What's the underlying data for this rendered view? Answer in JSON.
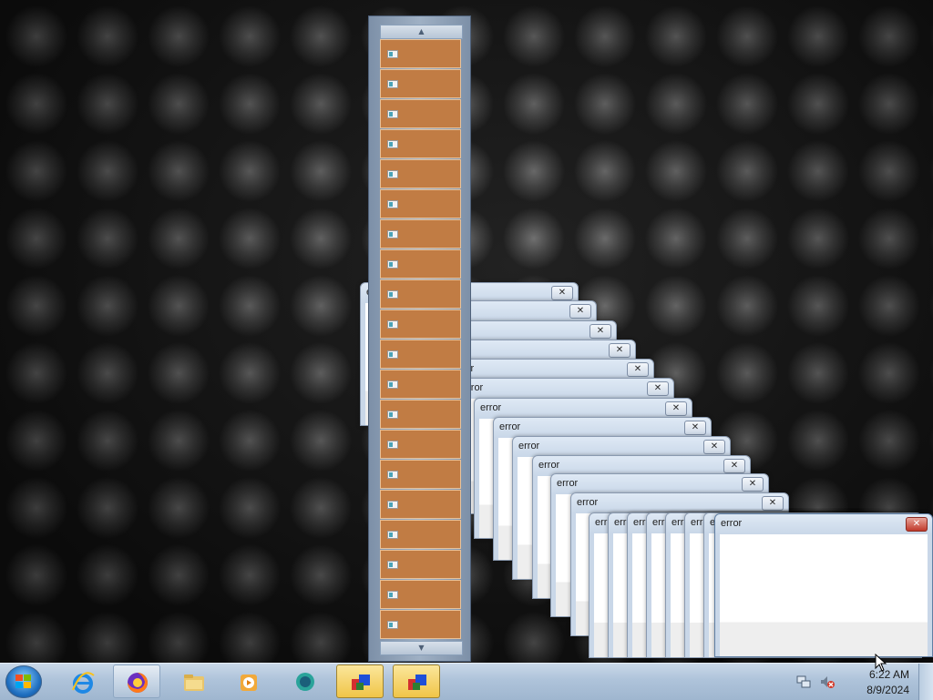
{
  "desktop": {
    "wallpaper": "dark-abstract-wallpaper"
  },
  "error_windows": {
    "title": "error",
    "close_glyph": "✕",
    "count": 23
  },
  "list_popup": {
    "scroll_up_glyph": "▲",
    "scroll_down_glyph": "▼",
    "item_count": 20,
    "item_icon": "app-window-icon"
  },
  "taskbar": {
    "start_icon": "windows-start-orb",
    "buttons": [
      {
        "name": "internet-explorer",
        "icon": "internet-explorer-icon",
        "state": "pinned"
      },
      {
        "name": "firefox",
        "icon": "firefox-icon",
        "state": "running"
      },
      {
        "name": "file-explorer",
        "icon": "folder-icon",
        "state": "pinned"
      },
      {
        "name": "media-player",
        "icon": "media-player-icon",
        "state": "pinned"
      },
      {
        "name": "chat-app",
        "icon": "chat-bubble-icon",
        "state": "pinned"
      },
      {
        "name": "cube-app-1",
        "icon": "cube-app-icon",
        "state": "highlight"
      },
      {
        "name": "cube-app-2",
        "icon": "cube-app-icon",
        "state": "highlight"
      }
    ],
    "tray": {
      "time": "6:22 AM",
      "date": "8/9/2024",
      "icons": [
        "network-icon",
        "volume-muted-icon"
      ]
    }
  },
  "colors": {
    "list_item": "#c17c44",
    "taskbar": "#aec3da",
    "active_close": "#c0392b"
  }
}
